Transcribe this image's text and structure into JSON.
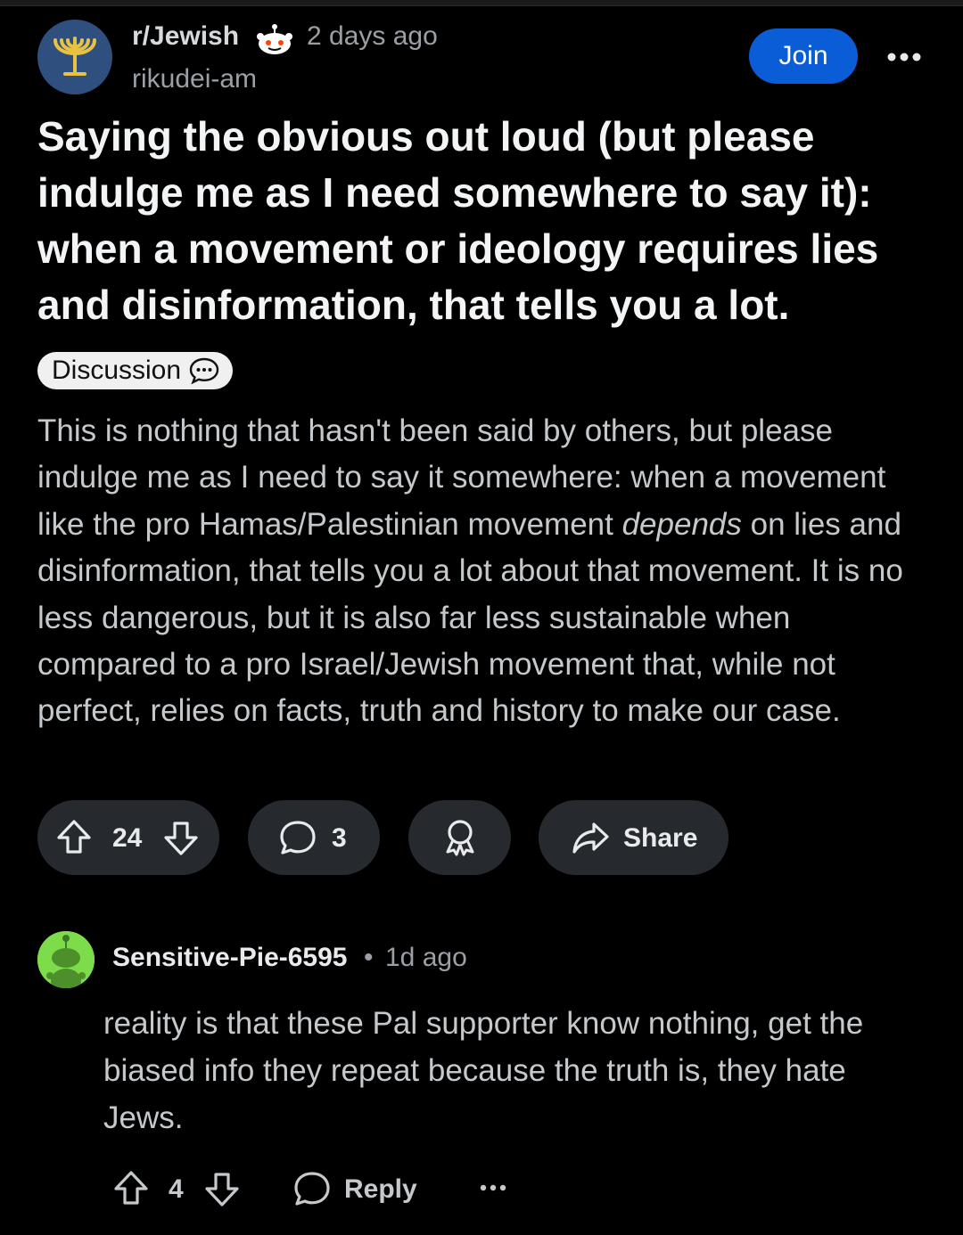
{
  "post": {
    "subreddit": "r/Jewish",
    "time": "2 days ago",
    "author": "rikudei-am",
    "join_label": "Join",
    "title": "Saying the obvious out loud (but please indulge me as I need somewhere to say it): when a movement or ideology requires lies and disinformation, that tells you a lot.",
    "flair": "Discussion",
    "body_part1": "This is nothing that hasn't been said by others, but please indulge me as I need to say it somewhere: when a movement like the pro Hamas/Palestinian movement ",
    "body_emph": "depends",
    "body_part2": " on lies and disinformation, that tells you a lot about that movement. It is no less dangerous, but it is also far less sustainable when compared to a pro Israel/Jewish movement that, while not perfect, relies on facts, truth and history to make our case.",
    "votes": "24",
    "comments": "3",
    "share_label": "Share"
  },
  "comment": {
    "author": "Sensitive-Pie-6595",
    "separator": "•",
    "time": "1d ago",
    "text": "reality is that these Pal supporter know nothing, get the biased info they repeat because the truth is, they hate Jews.",
    "votes": "4",
    "reply_label": "Reply"
  },
  "icons": {
    "subreddit_avatar": "menorah-icon",
    "snoo": "snoo-icon",
    "more": "more-horizontal-icon",
    "flair": "speech-bubble-icon",
    "upvote": "upvote-arrow-icon",
    "downvote": "downvote-arrow-icon",
    "comment": "comment-bubble-icon",
    "award": "award-ribbon-icon",
    "share": "share-arrow-icon"
  },
  "colors": {
    "background": "#000000",
    "join_button": "#0a5dd6",
    "pill": "#262a2e",
    "subreddit_avatar": "#2f4f7f",
    "user_avatar": "#7ddc4a"
  }
}
